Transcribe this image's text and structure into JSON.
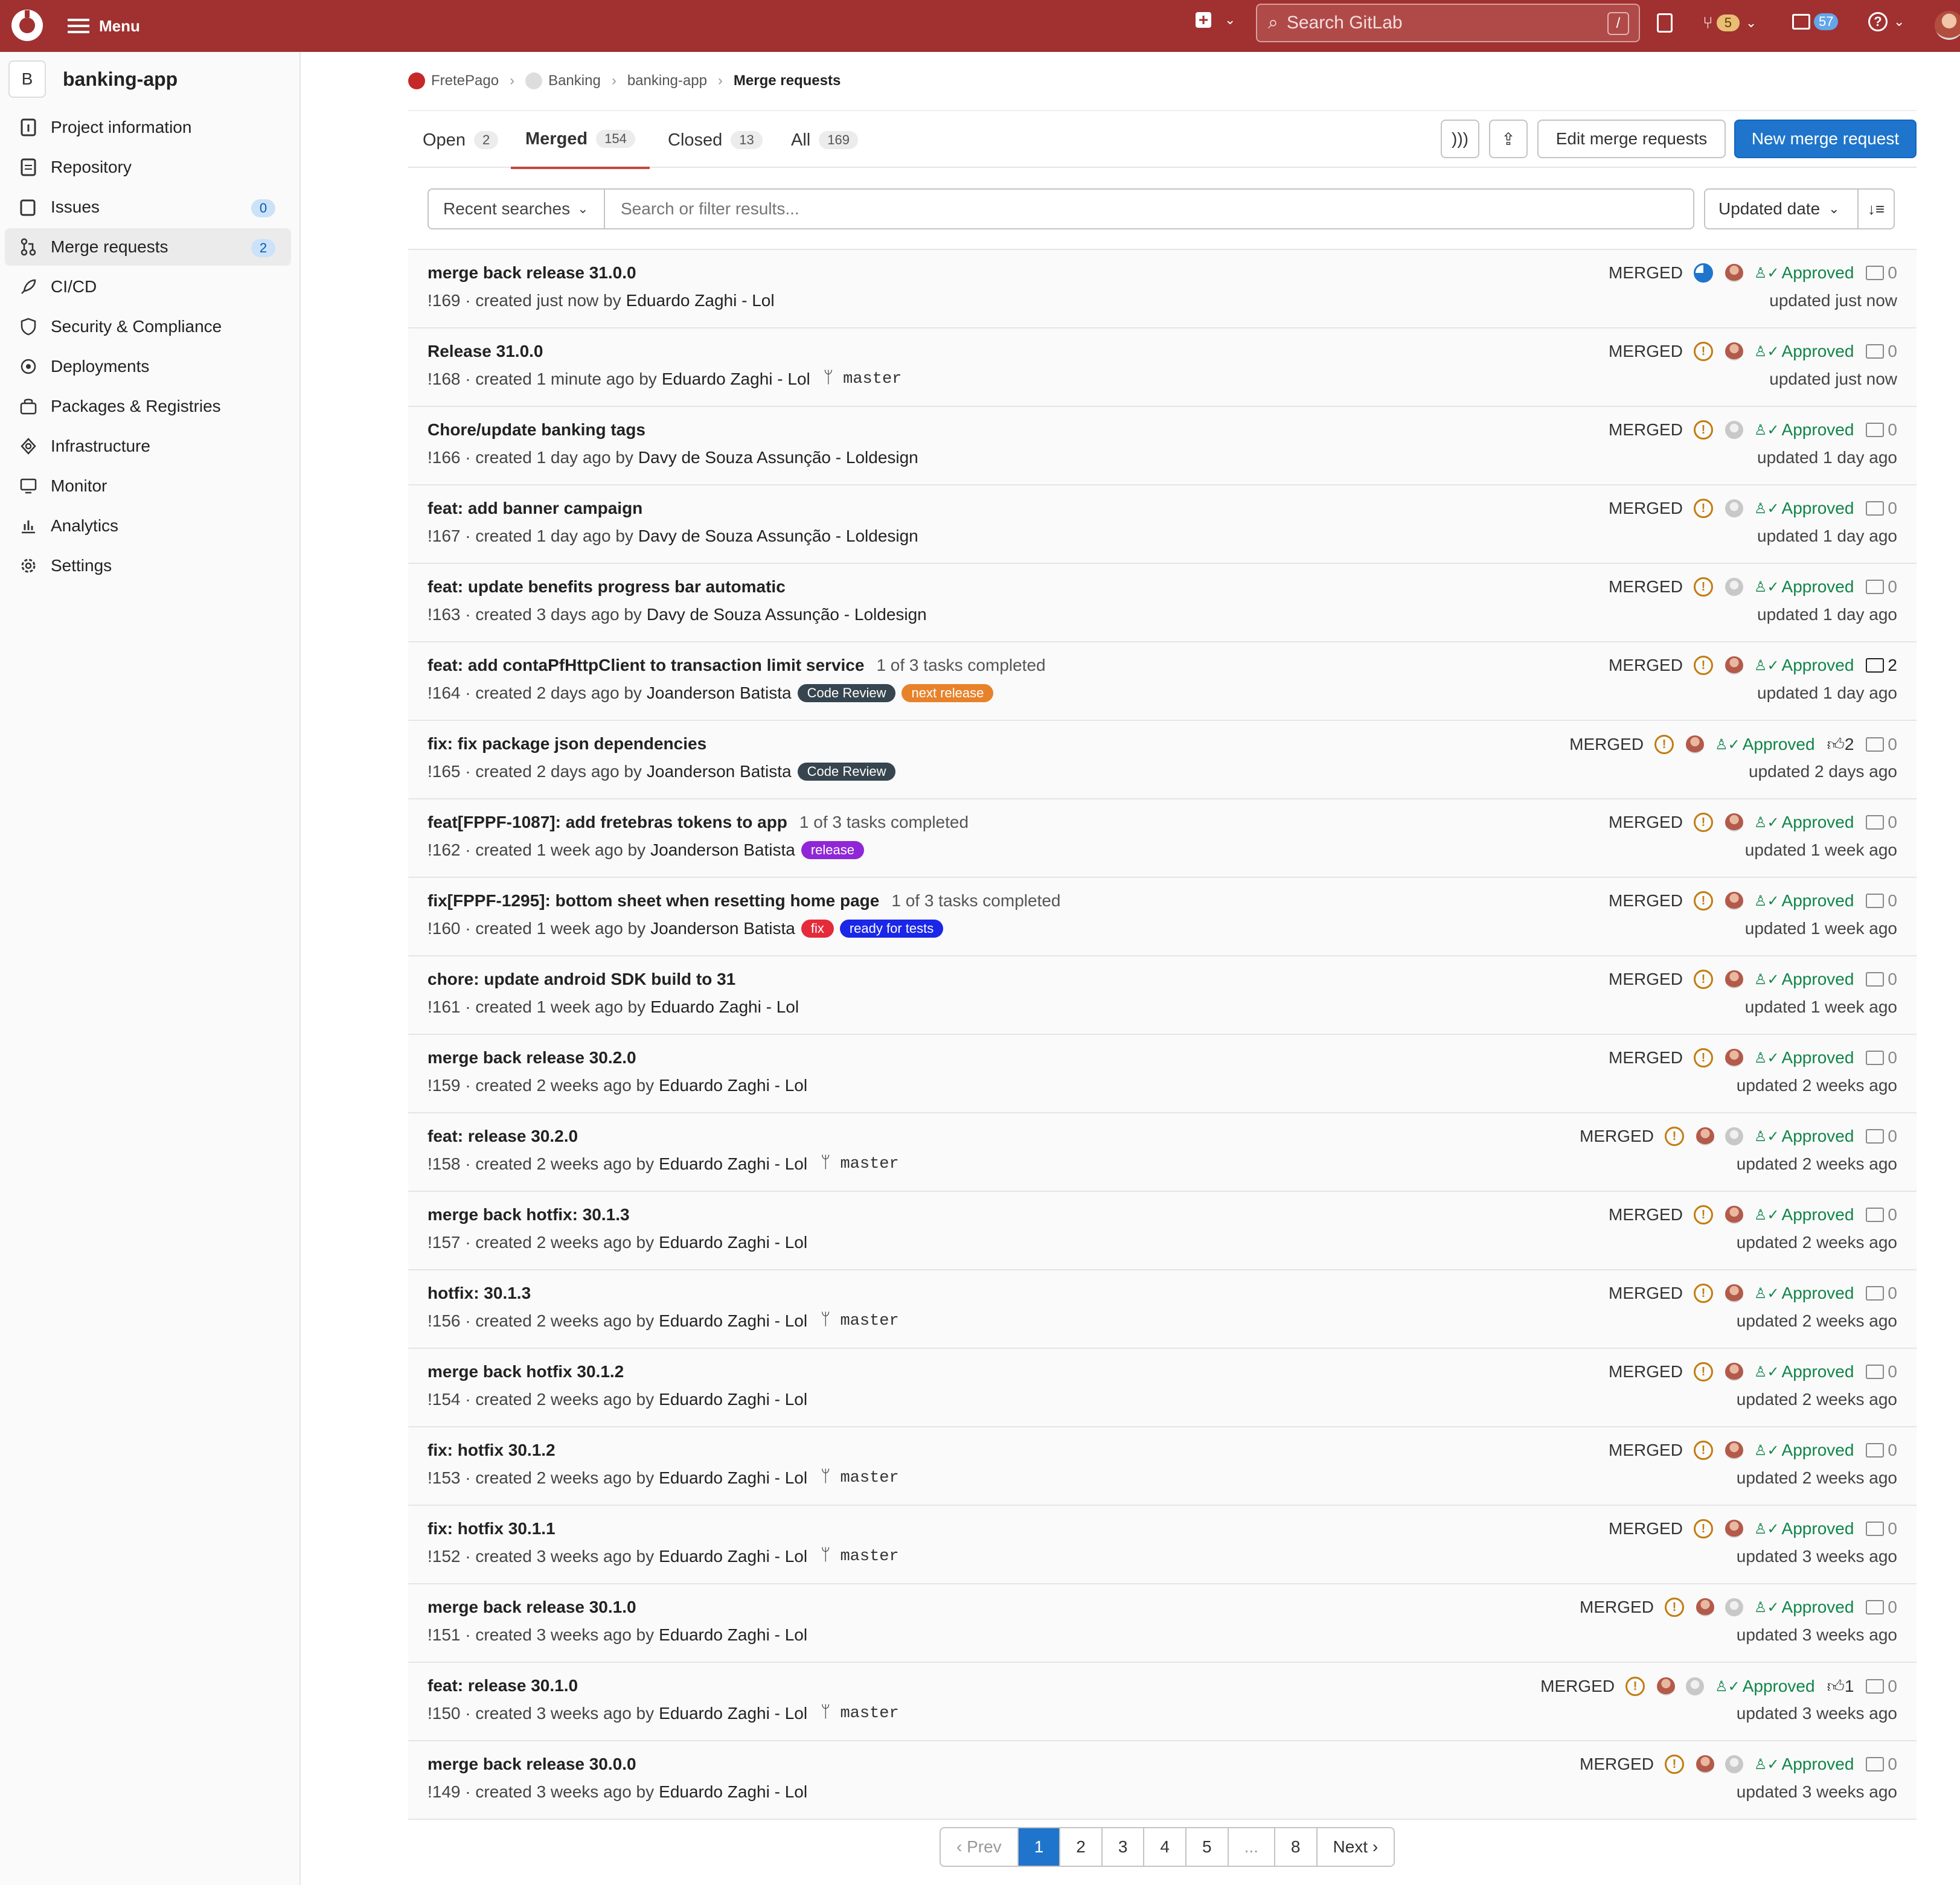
{
  "topbar": {
    "menu_label": "Menu",
    "search_placeholder": "Search GitLab",
    "search_shortcut": "/",
    "mr_count": "5",
    "todo_count": "57",
    "colors": {
      "bar": "#a03130"
    }
  },
  "sidebar": {
    "project_initial": "B",
    "project_name": "banking-app",
    "items": [
      {
        "label": "Project information",
        "icon": "info-icon"
      },
      {
        "label": "Repository",
        "icon": "document-icon"
      },
      {
        "label": "Issues",
        "icon": "issues-icon",
        "count": "0"
      },
      {
        "label": "Merge requests",
        "icon": "merge-request-icon",
        "count": "2",
        "active": true
      },
      {
        "label": "CI/CD",
        "icon": "rocket-icon"
      },
      {
        "label": "Security & Compliance",
        "icon": "shield-icon"
      },
      {
        "label": "Deployments",
        "icon": "deployments-icon"
      },
      {
        "label": "Packages & Registries",
        "icon": "package-icon"
      },
      {
        "label": "Infrastructure",
        "icon": "cloud-gear-icon"
      },
      {
        "label": "Monitor",
        "icon": "monitor-icon"
      },
      {
        "label": "Analytics",
        "icon": "chart-icon"
      },
      {
        "label": "Settings",
        "icon": "gear-icon"
      }
    ]
  },
  "breadcrumb": {
    "items": [
      "FretePago",
      "Banking",
      "banking-app"
    ],
    "current": "Merge requests"
  },
  "tabs": [
    {
      "label": "Open",
      "count": "2"
    },
    {
      "label": "Merged",
      "count": "154",
      "active": true
    },
    {
      "label": "Closed",
      "count": "13"
    },
    {
      "label": "All",
      "count": "169"
    }
  ],
  "actions": {
    "edit": "Edit merge requests",
    "new": "New merge request"
  },
  "filter": {
    "recent": "Recent searches",
    "placeholder": "Search or filter results...",
    "sort": "Updated date"
  },
  "merge_requests": [
    {
      "title": "merge back release 31.0.0",
      "iid": "!169",
      "created": "created just now by",
      "author": "Eduardo Zaghi - Lol",
      "state": "MERGED",
      "pipeline": "running",
      "approved": "Approved",
      "comments": "0",
      "updated": "updated just now"
    },
    {
      "title": "Release 31.0.0",
      "iid": "!168",
      "created": "created 1 minute ago by",
      "author": "Eduardo Zaghi - Lol",
      "branch": "master",
      "state": "MERGED",
      "pipeline": "warning",
      "approved": "Approved",
      "comments": "0",
      "updated": "updated just now"
    },
    {
      "title": "Chore/update banking tags",
      "iid": "!166",
      "created": "created 1 day ago by",
      "author": "Davy de Souza Assunção - Loldesign",
      "state": "MERGED",
      "pipeline": "warning",
      "avatar": "grey",
      "approved": "Approved",
      "comments": "0",
      "updated": "updated 1 day ago"
    },
    {
      "title": "feat: add banner campaign",
      "iid": "!167",
      "created": "created 1 day ago by",
      "author": "Davy de Souza Assunção - Loldesign",
      "state": "MERGED",
      "pipeline": "warning",
      "avatar": "grey",
      "approved": "Approved",
      "comments": "0",
      "updated": "updated 1 day ago"
    },
    {
      "title": "feat: update benefits progress bar automatic",
      "iid": "!163",
      "created": "created 3 days ago by",
      "author": "Davy de Souza Assunção - Loldesign",
      "state": "MERGED",
      "pipeline": "warning",
      "avatar": "grey",
      "approved": "Approved",
      "comments": "0",
      "updated": "updated 1 day ago"
    },
    {
      "title": "feat: add contaPfHttpClient to transaction limit service",
      "tasks": "1 of 3 tasks completed",
      "iid": "!164",
      "created": "created 2 days ago by",
      "author": "Joanderson Batista",
      "labels": [
        {
          "text": "Code Review",
          "color": "#36454f"
        },
        {
          "text": "next release",
          "color": "#e8822a"
        }
      ],
      "state": "MERGED",
      "pipeline": "warning",
      "approved": "Approved",
      "comments": "2",
      "updated": "updated 1 day ago"
    },
    {
      "title": "fix: fix package json dependencies",
      "iid": "!165",
      "created": "created 2 days ago by",
      "author": "Joanderson Batista",
      "labels": [
        {
          "text": "Code Review",
          "color": "#36454f"
        }
      ],
      "state": "MERGED",
      "pipeline": "warning",
      "approved": "Approved",
      "upvotes": "2",
      "comments": "0",
      "updated": "updated 2 days ago"
    },
    {
      "title": "feat[FPPF-1087]: add fretebras tokens to app",
      "tasks": "1 of 3 tasks completed",
      "iid": "!162",
      "created": "created 1 week ago by",
      "author": "Joanderson Batista",
      "labels": [
        {
          "text": "release",
          "color": "#8f27d6"
        }
      ],
      "state": "MERGED",
      "pipeline": "warning",
      "approved": "Approved",
      "comments": "0",
      "updated": "updated 1 week ago"
    },
    {
      "title": "fix[FPPF-1295]: bottom sheet when resetting home page",
      "tasks": "1 of 3 tasks completed",
      "iid": "!160",
      "created": "created 1 week ago by",
      "author": "Joanderson Batista",
      "labels": [
        {
          "text": "fix",
          "color": "#e32b3a"
        },
        {
          "text": "ready for tests",
          "color": "#1a26e8"
        }
      ],
      "state": "MERGED",
      "pipeline": "warning",
      "approved": "Approved",
      "comments": "0",
      "updated": "updated 1 week ago"
    },
    {
      "title": "chore: update android SDK build to 31",
      "iid": "!161",
      "created": "created 1 week ago by",
      "author": "Eduardo Zaghi - Lol",
      "state": "MERGED",
      "pipeline": "warning",
      "approved": "Approved",
      "comments": "0",
      "updated": "updated 1 week ago"
    },
    {
      "title": "merge back release 30.2.0",
      "iid": "!159",
      "created": "created 2 weeks ago by",
      "author": "Eduardo Zaghi - Lol",
      "state": "MERGED",
      "pipeline": "warning",
      "approved": "Approved",
      "comments": "0",
      "updated": "updated 2 weeks ago"
    },
    {
      "title": "feat: release 30.2.0",
      "iid": "!158",
      "created": "created 2 weeks ago by",
      "author": "Eduardo Zaghi - Lol",
      "branch": "master",
      "state": "MERGED",
      "pipeline": "warning",
      "avatar2": true,
      "approved": "Approved",
      "comments": "0",
      "updated": "updated 2 weeks ago"
    },
    {
      "title": "merge back hotfix: 30.1.3",
      "iid": "!157",
      "created": "created 2 weeks ago by",
      "author": "Eduardo Zaghi - Lol",
      "state": "MERGED",
      "pipeline": "warning",
      "approved": "Approved",
      "comments": "0",
      "updated": "updated 2 weeks ago"
    },
    {
      "title": "hotfix: 30.1.3",
      "iid": "!156",
      "created": "created 2 weeks ago by",
      "author": "Eduardo Zaghi - Lol",
      "branch": "master",
      "state": "MERGED",
      "pipeline": "warning",
      "approved": "Approved",
      "comments": "0",
      "updated": "updated 2 weeks ago"
    },
    {
      "title": "merge back hotfix 30.1.2",
      "iid": "!154",
      "created": "created 2 weeks ago by",
      "author": "Eduardo Zaghi - Lol",
      "state": "MERGED",
      "pipeline": "warning",
      "approved": "Approved",
      "comments": "0",
      "updated": "updated 2 weeks ago"
    },
    {
      "title": "fix: hotfix 30.1.2",
      "iid": "!153",
      "created": "created 2 weeks ago by",
      "author": "Eduardo Zaghi - Lol",
      "branch": "master",
      "state": "MERGED",
      "pipeline": "warning",
      "approved": "Approved",
      "comments": "0",
      "updated": "updated 2 weeks ago"
    },
    {
      "title": "fix: hotfix 30.1.1",
      "iid": "!152",
      "created": "created 3 weeks ago by",
      "author": "Eduardo Zaghi - Lol",
      "branch": "master",
      "state": "MERGED",
      "pipeline": "warning",
      "approved": "Approved",
      "comments": "0",
      "updated": "updated 3 weeks ago"
    },
    {
      "title": "merge back release 30.1.0",
      "iid": "!151",
      "created": "created 3 weeks ago by",
      "author": "Eduardo Zaghi - Lol",
      "state": "MERGED",
      "pipeline": "warning",
      "avatar2": true,
      "approved": "Approved",
      "comments": "0",
      "updated": "updated 3 weeks ago"
    },
    {
      "title": "feat: release 30.1.0",
      "iid": "!150",
      "created": "created 3 weeks ago by",
      "author": "Eduardo Zaghi - Lol",
      "branch": "master",
      "state": "MERGED",
      "pipeline": "warning",
      "avatar2": true,
      "approved": "Approved",
      "upvotes": "1",
      "comments": "0",
      "updated": "updated 3 weeks ago"
    },
    {
      "title": "merge back release 30.0.0",
      "iid": "!149",
      "created": "created 3 weeks ago by",
      "author": "Eduardo Zaghi - Lol",
      "state": "MERGED",
      "pipeline": "warning",
      "avatar2": true,
      "approved": "Approved",
      "comments": "0",
      "updated": "updated 3 weeks ago"
    }
  ],
  "pagination": {
    "prev": "‹ Prev",
    "pages": [
      "1",
      "2",
      "3",
      "4",
      "5",
      "...",
      "8"
    ],
    "current": "1",
    "next": "Next ›"
  }
}
